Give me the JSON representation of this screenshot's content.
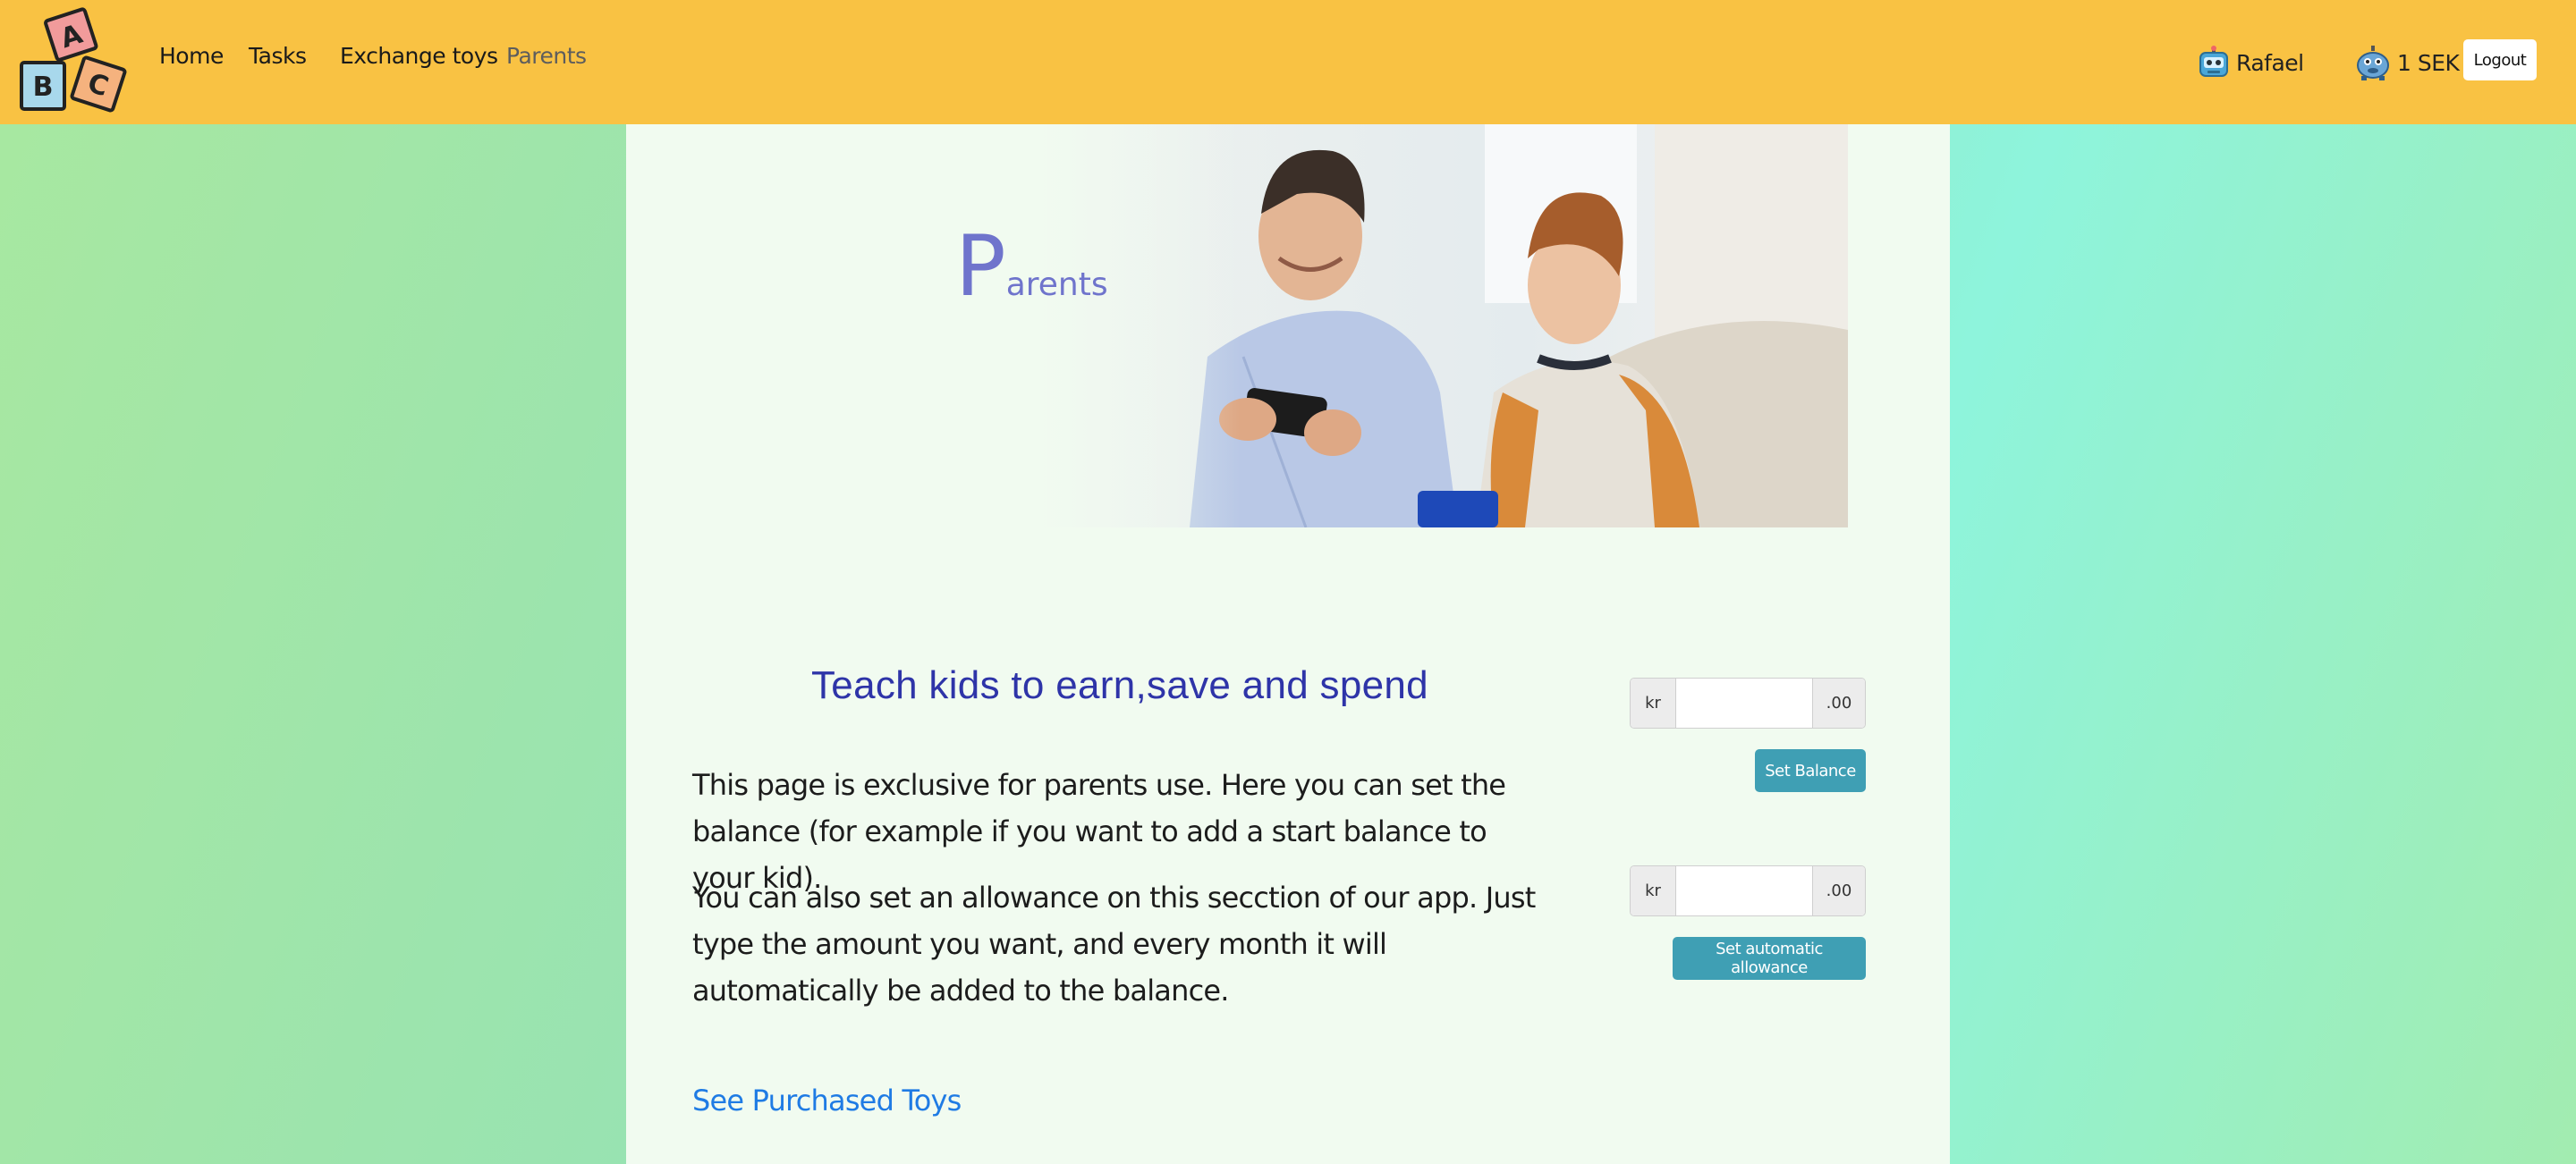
{
  "nav": {
    "home": "Home",
    "tasks": "Tasks",
    "exchange": "Exchange toys",
    "parents": "Parents"
  },
  "user": {
    "name": "Rafael",
    "balance": "1 SEK",
    "logout": "Logout"
  },
  "hero": {
    "title_initial": "P",
    "title_rest": "arents"
  },
  "main": {
    "tagline": "Teach kids to earn,save and spend",
    "paragraph1": "This page is exclusive for parents use. Here you can set the balance (for example if you want to add a start balance to your kid).",
    "paragraph2": "You can also set an allowance on this secction of our app. Just type the amount you want, and every month it will automatically be added to the balance.",
    "purchased_link": "See Purchased Toys"
  },
  "balance_form": {
    "prefix": "kr",
    "suffix": ".00",
    "value": "",
    "button": "Set Balance"
  },
  "allowance_form": {
    "prefix": "kr",
    "suffix": ".00",
    "value": "",
    "button": "Set automatic allowance"
  },
  "colors": {
    "navbar": "#f9c243",
    "accent_button": "#3f9fb4",
    "tagline": "#2e34a8",
    "link": "#1f7be4"
  },
  "icons": [
    "abc-blocks-logo",
    "robot-avatar-icon",
    "piggy-robot-icon",
    "family-hero-image"
  ]
}
